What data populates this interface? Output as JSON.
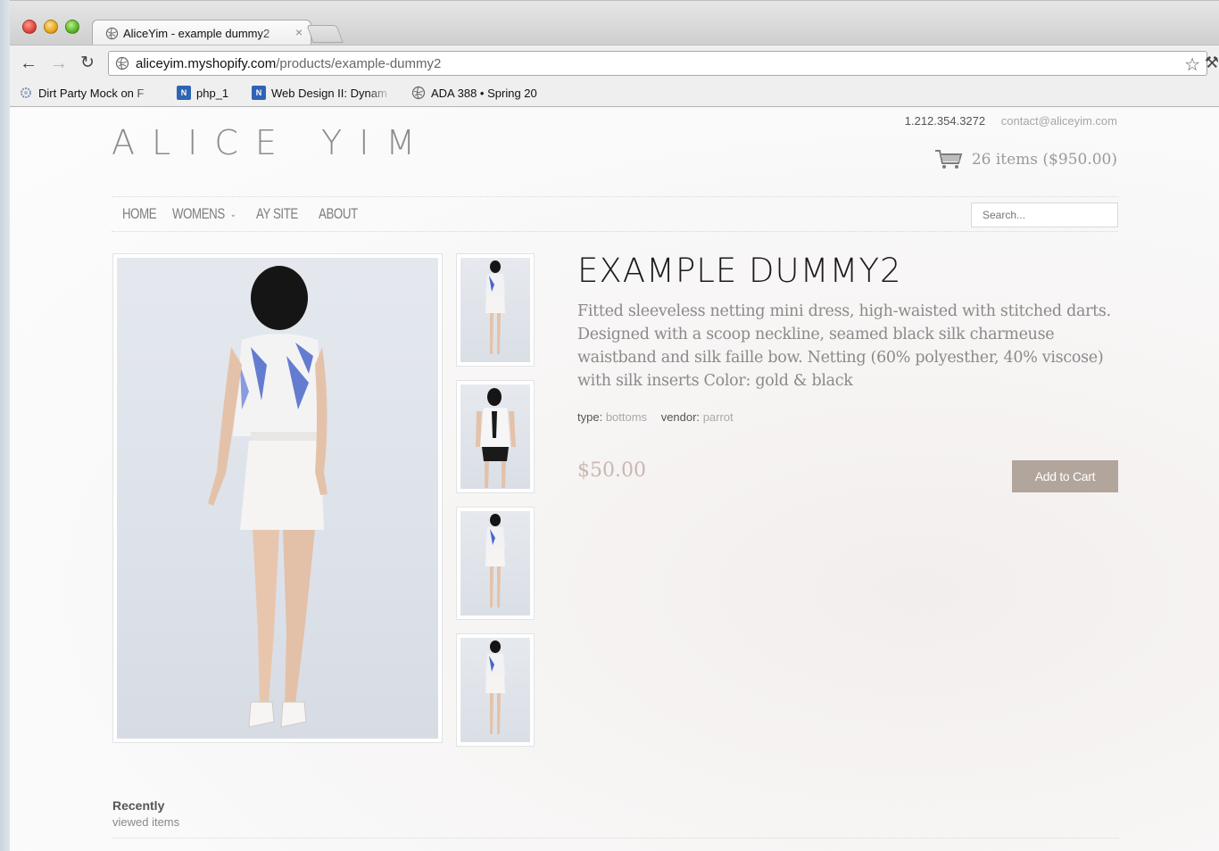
{
  "browser": {
    "tab_title": "AliceYim - example dummy2",
    "tab_close": "×",
    "url_domain": "aliceyim.myshopify.com",
    "url_path": "/products/example-dummy2",
    "bookmarks": [
      {
        "label": "Dirt Party Mock on F",
        "icon": "gear-favicon"
      },
      {
        "label": "php_1",
        "icon": "blue-favicon"
      },
      {
        "label": "Web Design II: Dynam",
        "icon": "blue-favicon"
      },
      {
        "label": "ADA 388 • Spring 20",
        "icon": "globe-favicon"
      }
    ]
  },
  "store": {
    "logo": "ALICE YIM",
    "phone": "1.212.354.3272",
    "email": "contact@aliceyim.com",
    "cart_summary": "26 items ($950.00)"
  },
  "nav": {
    "home": "HOME",
    "womens": "WOMENS",
    "ay_site": "AY SITE",
    "about": "ABOUT",
    "search_placeholder": "Search..."
  },
  "product": {
    "title": "EXAMPLE DUMMY2",
    "description": "Fitted sleeveless netting mini dress, high-waisted with stitched darts. Designed with a scoop neckline, seamed black silk charmeuse waistband and silk faille bow. Netting (60% polyesther, 40% viscose) with silk inserts Color: gold & black",
    "type_label": "type:",
    "type_value": "bottoms",
    "vendor_label": "vendor:",
    "vendor_value": "parrot",
    "price": "$50.00",
    "add_to_cart": "Add to Cart"
  },
  "recent": {
    "line1": "Recently",
    "line2": "viewed items"
  },
  "colors": {
    "accent_button": "#b2a59c",
    "price": "#c9b7b3",
    "text_muted": "#8a8a8a"
  }
}
